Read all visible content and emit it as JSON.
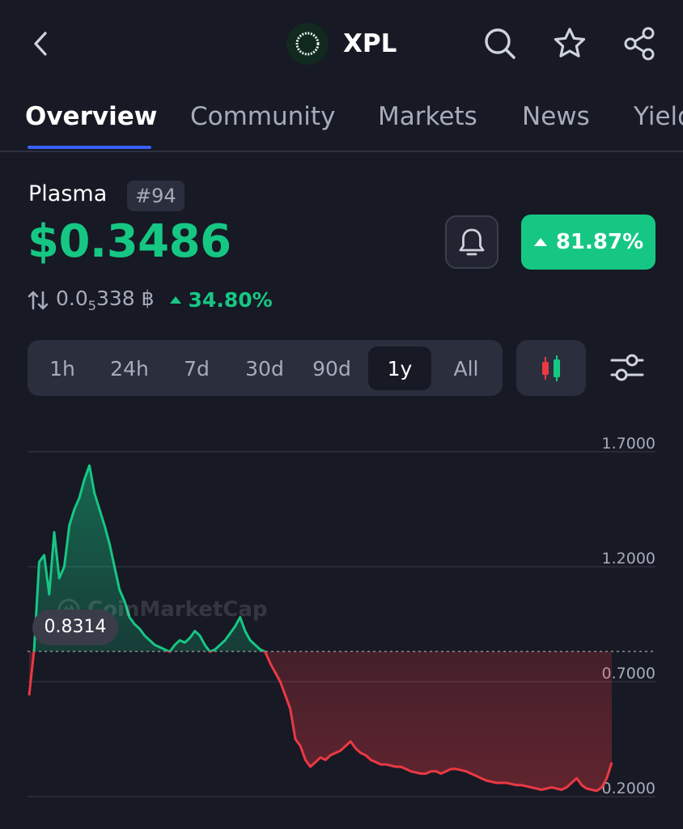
{
  "header": {
    "ticker": "XPL",
    "icons": [
      "back-arrow-icon",
      "search-icon",
      "star-icon",
      "share-icon"
    ]
  },
  "tabs": [
    {
      "label": "Overview",
      "active": true
    },
    {
      "label": "Community",
      "active": false
    },
    {
      "label": "Markets",
      "active": false
    },
    {
      "label": "News",
      "active": false
    },
    {
      "label": "Yield",
      "active": false
    }
  ],
  "coin": {
    "name": "Plasma",
    "rank": "#94",
    "price": "$0.3486",
    "change_pct": "81.87%",
    "btc_price_prefix": "0.0",
    "btc_price_sub": "5",
    "btc_price_rest": "338",
    "btc_symbol": "฿",
    "btc_change": "34.80%"
  },
  "ranges": [
    {
      "label": "1h",
      "active": false
    },
    {
      "label": "24h",
      "active": false
    },
    {
      "label": "7d",
      "active": false
    },
    {
      "label": "30d",
      "active": false
    },
    {
      "label": "90d",
      "active": false
    },
    {
      "label": "1y",
      "active": true
    },
    {
      "label": "All",
      "active": false
    }
  ],
  "colors": {
    "up": "#16c784",
    "down": "#ea3943",
    "accent": "#3861fb",
    "background": "#171924"
  },
  "chart": {
    "tooltip_value": "0.8314",
    "watermark": "CoinMarketCap"
  },
  "chart_data": {
    "type": "line",
    "ylim": [
      0.2,
      1.7
    ],
    "y_ticks": [
      "1.7000",
      "1.2000",
      "0.7000",
      "0.2000"
    ],
    "reference_value": 0.8314,
    "grid": true,
    "values": [
      0.64,
      0.84,
      1.22,
      1.25,
      1.08,
      1.35,
      1.15,
      1.2,
      1.38,
      1.45,
      1.5,
      1.58,
      1.64,
      1.52,
      1.45,
      1.38,
      1.3,
      1.2,
      1.1,
      1.05,
      0.98,
      0.95,
      0.93,
      0.9,
      0.88,
      0.86,
      0.85,
      0.84,
      0.83,
      0.86,
      0.88,
      0.87,
      0.89,
      0.92,
      0.9,
      0.86,
      0.83,
      0.84,
      0.86,
      0.88,
      0.91,
      0.94,
      0.98,
      0.92,
      0.88,
      0.86,
      0.84,
      0.83,
      0.78,
      0.74,
      0.7,
      0.64,
      0.58,
      0.45,
      0.42,
      0.36,
      0.33,
      0.35,
      0.37,
      0.36,
      0.38,
      0.39,
      0.4,
      0.42,
      0.44,
      0.41,
      0.39,
      0.38,
      0.36,
      0.35,
      0.34,
      0.34,
      0.335,
      0.33,
      0.33,
      0.32,
      0.31,
      0.305,
      0.3,
      0.3,
      0.31,
      0.31,
      0.3,
      0.31,
      0.32,
      0.32,
      0.315,
      0.31,
      0.3,
      0.29,
      0.28,
      0.27,
      0.265,
      0.26,
      0.26,
      0.26,
      0.255,
      0.25,
      0.25,
      0.245,
      0.24,
      0.235,
      0.23,
      0.235,
      0.24,
      0.235,
      0.23,
      0.24,
      0.26,
      0.28,
      0.25,
      0.235,
      0.23,
      0.225,
      0.24,
      0.28,
      0.3486
    ]
  }
}
